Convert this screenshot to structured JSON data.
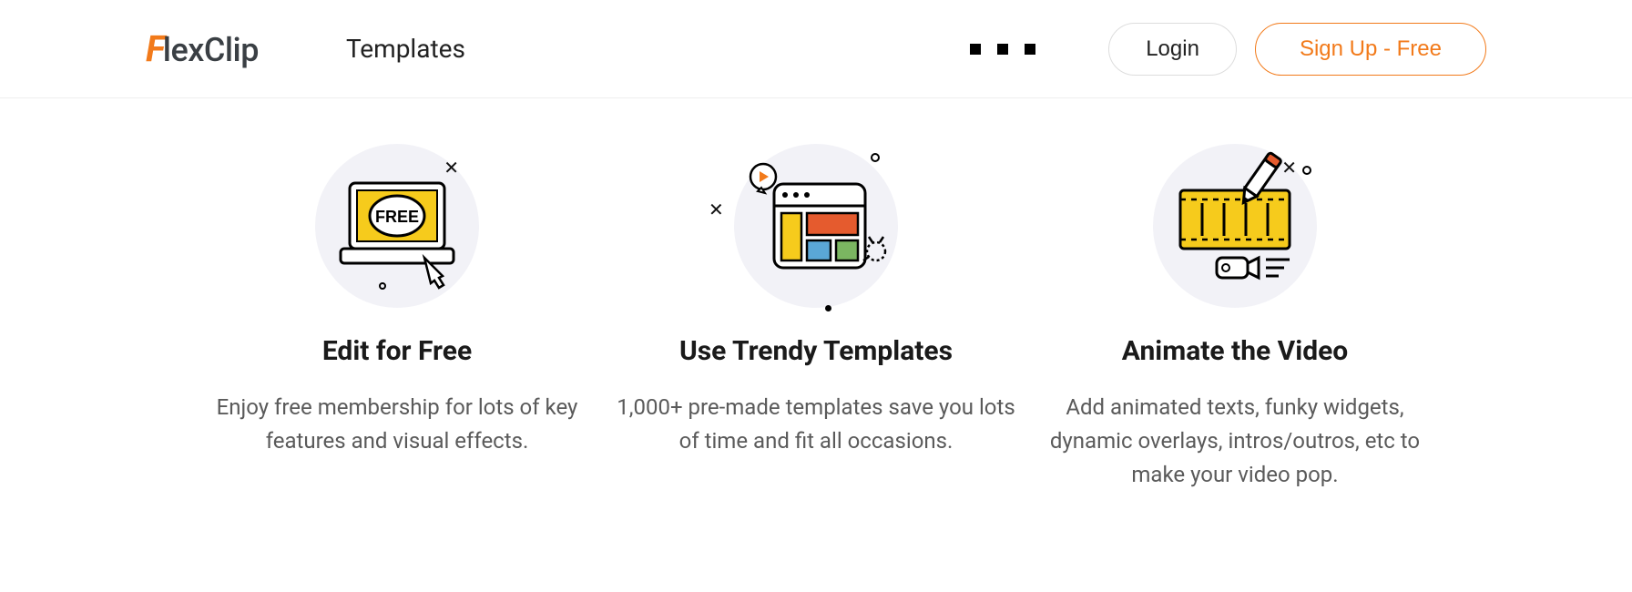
{
  "brand": {
    "name": "FlexClip",
    "accent": "#f27a1a"
  },
  "header": {
    "nav_templates": "Templates",
    "login_label": "Login",
    "signup_label": "Sign Up - Free"
  },
  "features": [
    {
      "icon": "laptop-free-icon",
      "title": "Edit for Free",
      "desc": "Enjoy free membership for lots of key features and visual effects."
    },
    {
      "icon": "templates-icon",
      "title": "Use Trendy Templates",
      "desc": "1,000+ pre-made templates save you lots of time and fit all occasions."
    },
    {
      "icon": "animate-video-icon",
      "title": "Animate the Video",
      "desc": "Add animated texts, funky widgets, dynamic overlays, intros/outros, etc to make your video pop."
    }
  ]
}
